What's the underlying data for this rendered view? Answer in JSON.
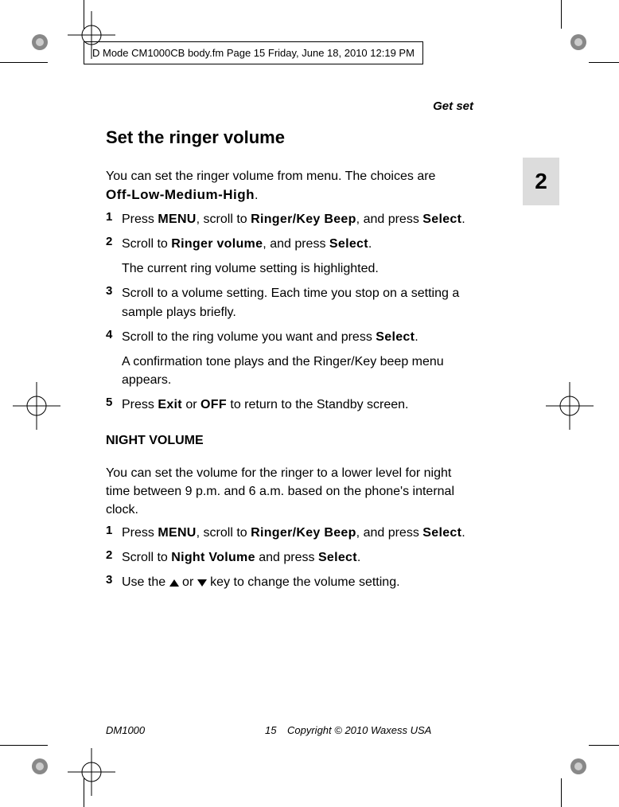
{
  "header_info": "D Mode CM1000CB body.fm  Page 15  Friday, June 18, 2010  12:19 PM",
  "section_label": "Get set",
  "chapter_number": "2",
  "heading": "Set the ringer volume",
  "intro": "You can set the ringer volume from menu. The choices are",
  "choices": "Off-Low-Medium-High",
  "steps_a": [
    {
      "num": "1",
      "pre": "Press ",
      "ui1": "MENU",
      "mid1": ", scroll to ",
      "ui2": "Ringer/Key Beep",
      "mid2": ", and press ",
      "ui3": "Select",
      "post": "."
    },
    {
      "num": "2",
      "pre": "Scroll to ",
      "ui1": "Ringer volume",
      "mid1": ", and press ",
      "ui2": "Select",
      "post": "."
    },
    {
      "num": "3",
      "text": "Scroll to a volume setting. Each time you stop on a setting a sample plays briefly."
    },
    {
      "num": "4",
      "pre": "Scroll to the ring volume you want and press ",
      "ui1": "Select",
      "post": "."
    },
    {
      "num": "5",
      "pre": "Press ",
      "ui1": "Exit",
      "mid1": " or ",
      "ui2": "OFF",
      "post": " to return to the Standby screen."
    }
  ],
  "note_a1": "The current ring volume setting is highlighted.",
  "note_a2": "A confirmation tone plays and the Ringer/Key beep menu appears.",
  "subheading": "NIGHT VOLUME",
  "intro_b": "You can set the volume for the ringer to a lower level for night time between 9 p.m. and 6 a.m. based on the phone's internal clock.",
  "steps_b": [
    {
      "num": "1",
      "pre": "Press ",
      "ui1": "MENU",
      "mid1": ", scroll to ",
      "ui2": "Ringer/Key Beep",
      "mid2": ", and press ",
      "ui3": "Select",
      "post": "."
    },
    {
      "num": "2",
      "pre": "Scroll to ",
      "ui1": "Night Volume",
      "mid1": " and press ",
      "ui2": "Select",
      "post": "."
    },
    {
      "num": "3",
      "pre": "Use the ",
      "mid1": " or ",
      "post": " key to change the volume setting."
    }
  ],
  "footer": {
    "model": "DM1000",
    "page": "15",
    "copyright": "Copyright © 2010 Waxess USA"
  }
}
